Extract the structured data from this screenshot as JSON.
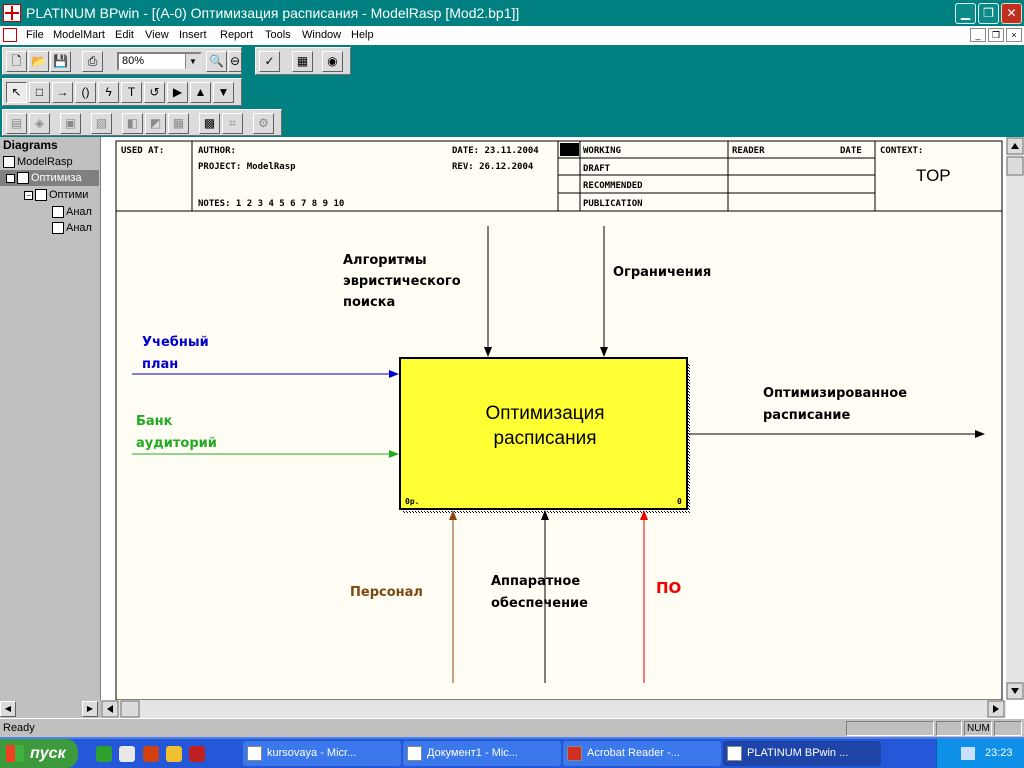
{
  "window": {
    "title": "PLATINUM BPwin - [(A-0) Оптимизация расписания - ModelRasp  [Mod2.bp1]]"
  },
  "menu": [
    "File",
    "ModelMart",
    "Edit",
    "View",
    "Insert",
    "Report",
    "Tools",
    "Window",
    "Help"
  ],
  "toolbar": {
    "zoom": "80%"
  },
  "left_pane": {
    "title": "Diagrams",
    "tree": [
      "ModelRasp",
      "Оптимиза",
      "Оптими",
      "Анал",
      "Анал"
    ]
  },
  "frame": {
    "used_at": "USED AT:",
    "author": "AUTHOR:",
    "project": "PROJECT: ModelRasp",
    "date": "DATE: 23.11.2004",
    "rev": "REV:  26.12.2004",
    "notes": "NOTES:  1  2  3  4  5  6  7  8  9  10",
    "statuses": [
      "WORKING",
      "DRAFT",
      "RECOMMENDED",
      "PUBLICATION"
    ],
    "reader": "READER",
    "date_col": "DATE",
    "context": "CONTEXT:",
    "top": "TOP"
  },
  "diagram": {
    "box": {
      "line1": "Оптимизация",
      "line2": "расписания",
      "op": "0р.",
      "num": "0"
    },
    "arrows": {
      "control1": [
        "Алгоритмы",
        "эвристического",
        "поиска"
      ],
      "control2": "Ограничения",
      "input1": [
        "Учебный",
        "план"
      ],
      "input2": [
        "Банк",
        "аудиторий"
      ],
      "output": [
        "Оптимизированное",
        "расписание"
      ],
      "mech1": "Персонал",
      "mech2": [
        "Аппаратное",
        "обеспечение"
      ],
      "mech3": "ПО"
    },
    "colors": {
      "box_fill": "#ffff33",
      "input1": "#0000cc",
      "input2": "#22aa22",
      "mech1": "#8b4513",
      "mech3": "#ee0000",
      "label_input1": "#0000cc",
      "label_input2": "#22aa22",
      "label_mech1": "#7a4a10",
      "label_mech3": "#ee0000"
    }
  },
  "status": {
    "text": "Ready",
    "num": "NUM"
  },
  "taskbar": {
    "start": "пуск",
    "tasks": [
      "kursovaya - Micr...",
      "Документ1 - Mic...",
      "Acrobat Reader -...",
      "PLATINUM BPwin ..."
    ],
    "clock": "23:23"
  }
}
